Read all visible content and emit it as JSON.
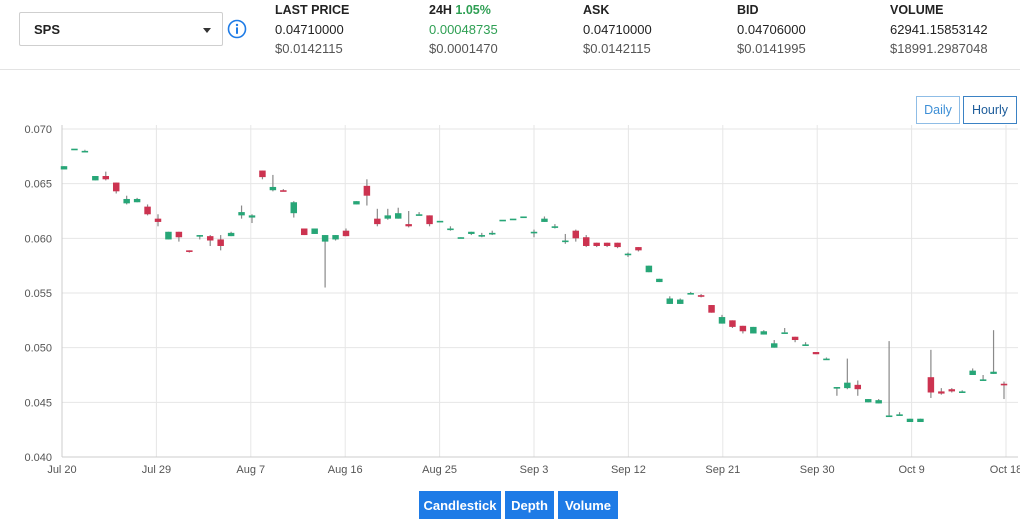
{
  "pair": {
    "label": "SPS"
  },
  "stats": {
    "last_price": {
      "title": "LAST PRICE",
      "value": "0.04710000",
      "usd": "$0.0142115"
    },
    "change_24h": {
      "title": "24H",
      "pct": "1.05%",
      "value": "0.00048735",
      "usd": "$0.0001470"
    },
    "ask": {
      "title": "ASK",
      "value": "0.04710000",
      "usd": "$0.0142115"
    },
    "bid": {
      "title": "BID",
      "value": "0.04706000",
      "usd": "$0.0141995"
    },
    "volume": {
      "title": "VOLUME",
      "value": "62941.15853142",
      "usd": "$18991.2987048"
    }
  },
  "range_buttons": {
    "daily": "Daily",
    "hourly": "Hourly"
  },
  "view_tabs": {
    "candlestick": "Candlestick",
    "depth": "Depth",
    "volume": "Volume"
  },
  "colors": {
    "up": "#27a677",
    "down": "#cc3350",
    "wick": "#8a8a8a",
    "accent": "#1e7be6",
    "positive_text": "#2e9f53"
  },
  "chart_data": {
    "type": "candlestick",
    "title": "",
    "xlabel": "",
    "ylabel": "",
    "ylim": [
      0.04,
      0.07
    ],
    "yticks": [
      "0.040",
      "0.045",
      "0.050",
      "0.055",
      "0.060",
      "0.065",
      "0.070"
    ],
    "x_start": "Jul 20",
    "x_end": "Oct 18",
    "xticks": [
      "Jul 20",
      "Jul 29",
      "Aug 7",
      "Aug 16",
      "Aug 25",
      "Sep 3",
      "Sep 12",
      "Sep 21",
      "Sep 30",
      "Oct 9",
      "Oct 18"
    ],
    "grid": true,
    "candles": [
      {
        "o": 0.0663,
        "h": 0.0666,
        "l": 0.0663,
        "c": 0.0666
      },
      {
        "o": 0.0682,
        "h": 0.0682,
        "l": 0.0682,
        "c": 0.0682
      },
      {
        "o": 0.068,
        "h": 0.0681,
        "l": 0.068,
        "c": 0.068
      },
      {
        "o": 0.0653,
        "h": 0.0657,
        "l": 0.0653,
        "c": 0.0657
      },
      {
        "o": 0.0657,
        "h": 0.0661,
        "l": 0.0653,
        "c": 0.0654
      },
      {
        "o": 0.0651,
        "h": 0.0651,
        "l": 0.0641,
        "c": 0.0643
      },
      {
        "o": 0.0632,
        "h": 0.0639,
        "l": 0.0631,
        "c": 0.0636
      },
      {
        "o": 0.0633,
        "h": 0.0637,
        "l": 0.0633,
        "c": 0.0636
      },
      {
        "o": 0.0629,
        "h": 0.0631,
        "l": 0.0621,
        "c": 0.0622
      },
      {
        "o": 0.0618,
        "h": 0.0622,
        "l": 0.0611,
        "c": 0.0615
      },
      {
        "o": 0.0599,
        "h": 0.0606,
        "l": 0.0599,
        "c": 0.0606
      },
      {
        "o": 0.0606,
        "h": 0.0606,
        "l": 0.0597,
        "c": 0.0601
      },
      {
        "o": 0.0589,
        "h": 0.0589,
        "l": 0.0587,
        "c": 0.0588
      },
      {
        "o": 0.0603,
        "h": 0.0603,
        "l": 0.0599,
        "c": 0.0603
      },
      {
        "o": 0.0602,
        "h": 0.0603,
        "l": 0.0593,
        "c": 0.0598
      },
      {
        "o": 0.0599,
        "h": 0.0603,
        "l": 0.0589,
        "c": 0.0593
      },
      {
        "o": 0.0602,
        "h": 0.0606,
        "l": 0.0602,
        "c": 0.0605
      },
      {
        "o": 0.0621,
        "h": 0.063,
        "l": 0.0618,
        "c": 0.0624
      },
      {
        "o": 0.0619,
        "h": 0.0622,
        "l": 0.0614,
        "c": 0.0621
      },
      {
        "o": 0.0662,
        "h": 0.0662,
        "l": 0.0654,
        "c": 0.0656
      },
      {
        "o": 0.0644,
        "h": 0.0658,
        "l": 0.0643,
        "c": 0.0647
      },
      {
        "o": 0.0644,
        "h": 0.0645,
        "l": 0.0643,
        "c": 0.0643
      },
      {
        "o": 0.0623,
        "h": 0.0634,
        "l": 0.0619,
        "c": 0.0633
      },
      {
        "o": 0.0609,
        "h": 0.0609,
        "l": 0.0603,
        "c": 0.0603
      },
      {
        "o": 0.0604,
        "h": 0.0609,
        "l": 0.0604,
        "c": 0.0609
      },
      {
        "o": 0.0597,
        "h": 0.0603,
        "l": 0.0555,
        "c": 0.0603
      },
      {
        "o": 0.0599,
        "h": 0.0603,
        "l": 0.0598,
        "c": 0.0603
      },
      {
        "o": 0.0607,
        "h": 0.0609,
        "l": 0.0602,
        "c": 0.0602
      },
      {
        "o": 0.0631,
        "h": 0.0634,
        "l": 0.0631,
        "c": 0.0634
      },
      {
        "o": 0.0648,
        "h": 0.0654,
        "l": 0.063,
        "c": 0.0639
      },
      {
        "o": 0.0618,
        "h": 0.0627,
        "l": 0.0611,
        "c": 0.0613
      },
      {
        "o": 0.0618,
        "h": 0.0627,
        "l": 0.0617,
        "c": 0.0621
      },
      {
        "o": 0.0618,
        "h": 0.0628,
        "l": 0.0618,
        "c": 0.0623
      },
      {
        "o": 0.0613,
        "h": 0.0625,
        "l": 0.061,
        "c": 0.0611
      },
      {
        "o": 0.0621,
        "h": 0.0624,
        "l": 0.0621,
        "c": 0.0622
      },
      {
        "o": 0.0621,
        "h": 0.0621,
        "l": 0.0611,
        "c": 0.0613
      },
      {
        "o": 0.0616,
        "h": 0.0616,
        "l": 0.0616,
        "c": 0.0616
      },
      {
        "o": 0.0609,
        "h": 0.0611,
        "l": 0.0607,
        "c": 0.0609
      },
      {
        "o": 0.0601,
        "h": 0.0601,
        "l": 0.06,
        "c": 0.0601
      },
      {
        "o": 0.0604,
        "h": 0.0606,
        "l": 0.0603,
        "c": 0.0606
      },
      {
        "o": 0.0603,
        "h": 0.0605,
        "l": 0.0601,
        "c": 0.0603
      },
      {
        "o": 0.0605,
        "h": 0.0607,
        "l": 0.0603,
        "c": 0.0605
      },
      {
        "o": 0.0617,
        "h": 0.0617,
        "l": 0.0617,
        "c": 0.0617
      },
      {
        "o": 0.0618,
        "h": 0.0618,
        "l": 0.0618,
        "c": 0.0618
      },
      {
        "o": 0.062,
        "h": 0.062,
        "l": 0.062,
        "c": 0.062
      },
      {
        "o": 0.0606,
        "h": 0.0608,
        "l": 0.0601,
        "c": 0.0606
      },
      {
        "o": 0.0615,
        "h": 0.062,
        "l": 0.0615,
        "c": 0.0618
      },
      {
        "o": 0.0611,
        "h": 0.0613,
        "l": 0.0609,
        "c": 0.0611
      },
      {
        "o": 0.0598,
        "h": 0.0604,
        "l": 0.0595,
        "c": 0.0598
      },
      {
        "o": 0.0607,
        "h": 0.0608,
        "l": 0.0597,
        "c": 0.06
      },
      {
        "o": 0.0601,
        "h": 0.0603,
        "l": 0.0592,
        "c": 0.0593
      },
      {
        "o": 0.0596,
        "h": 0.0596,
        "l": 0.0592,
        "c": 0.0593
      },
      {
        "o": 0.0596,
        "h": 0.0596,
        "l": 0.0592,
        "c": 0.0593
      },
      {
        "o": 0.0596,
        "h": 0.0596,
        "l": 0.0591,
        "c": 0.0592
      },
      {
        "o": 0.0586,
        "h": 0.0587,
        "l": 0.0583,
        "c": 0.0586
      },
      {
        "o": 0.0592,
        "h": 0.0592,
        "l": 0.0588,
        "c": 0.0589
      },
      {
        "o": 0.0569,
        "h": 0.0575,
        "l": 0.0569,
        "c": 0.0575
      },
      {
        "o": 0.056,
        "h": 0.0563,
        "l": 0.056,
        "c": 0.0563
      },
      {
        "o": 0.054,
        "h": 0.0547,
        "l": 0.054,
        "c": 0.0545
      },
      {
        "o": 0.054,
        "h": 0.0545,
        "l": 0.054,
        "c": 0.0544
      },
      {
        "o": 0.0549,
        "h": 0.0551,
        "l": 0.0549,
        "c": 0.055
      },
      {
        "o": 0.0548,
        "h": 0.0549,
        "l": 0.0546,
        "c": 0.0547
      },
      {
        "o": 0.0539,
        "h": 0.0539,
        "l": 0.0532,
        "c": 0.0532
      },
      {
        "o": 0.0522,
        "h": 0.053,
        "l": 0.0522,
        "c": 0.0528
      },
      {
        "o": 0.0525,
        "h": 0.0525,
        "l": 0.0518,
        "c": 0.0519
      },
      {
        "o": 0.052,
        "h": 0.052,
        "l": 0.0513,
        "c": 0.0515
      },
      {
        "o": 0.0513,
        "h": 0.0519,
        "l": 0.0513,
        "c": 0.0519
      },
      {
        "o": 0.0512,
        "h": 0.0516,
        "l": 0.0512,
        "c": 0.0515
      },
      {
        "o": 0.05,
        "h": 0.0507,
        "l": 0.05,
        "c": 0.0504
      },
      {
        "o": 0.0514,
        "h": 0.0518,
        "l": 0.0514,
        "c": 0.0514
      },
      {
        "o": 0.051,
        "h": 0.051,
        "l": 0.0505,
        "c": 0.0507
      },
      {
        "o": 0.0503,
        "h": 0.0505,
        "l": 0.0502,
        "c": 0.0503
      },
      {
        "o": 0.0496,
        "h": 0.0496,
        "l": 0.0494,
        "c": 0.0494
      },
      {
        "o": 0.049,
        "h": 0.0491,
        "l": 0.049,
        "c": 0.049
      },
      {
        "o": 0.0463,
        "h": 0.0464,
        "l": 0.0456,
        "c": 0.0464
      },
      {
        "o": 0.0463,
        "h": 0.049,
        "l": 0.0462,
        "c": 0.0468
      },
      {
        "o": 0.0466,
        "h": 0.047,
        "l": 0.0456,
        "c": 0.0462
      },
      {
        "o": 0.045,
        "h": 0.0453,
        "l": 0.045,
        "c": 0.0453
      },
      {
        "o": 0.0449,
        "h": 0.0453,
        "l": 0.0449,
        "c": 0.0452
      },
      {
        "o": 0.0438,
        "h": 0.0506,
        "l": 0.0438,
        "c": 0.0438
      },
      {
        "o": 0.0438,
        "h": 0.0441,
        "l": 0.0438,
        "c": 0.0439
      },
      {
        "o": 0.0432,
        "h": 0.0435,
        "l": 0.0432,
        "c": 0.0435
      },
      {
        "o": 0.0432,
        "h": 0.0435,
        "l": 0.0432,
        "c": 0.0435
      },
      {
        "o": 0.0473,
        "h": 0.0498,
        "l": 0.0454,
        "c": 0.0459
      },
      {
        "o": 0.046,
        "h": 0.0463,
        "l": 0.0457,
        "c": 0.0458
      },
      {
        "o": 0.0462,
        "h": 0.0463,
        "l": 0.0459,
        "c": 0.046
      },
      {
        "o": 0.046,
        "h": 0.0461,
        "l": 0.0459,
        "c": 0.046
      },
      {
        "o": 0.0475,
        "h": 0.0481,
        "l": 0.0475,
        "c": 0.0479
      },
      {
        "o": 0.047,
        "h": 0.0475,
        "l": 0.047,
        "c": 0.0471
      },
      {
        "o": 0.0476,
        "h": 0.0516,
        "l": 0.0476,
        "c": 0.0478
      },
      {
        "o": 0.0467,
        "h": 0.0469,
        "l": 0.0453,
        "c": 0.0466
      }
    ]
  }
}
